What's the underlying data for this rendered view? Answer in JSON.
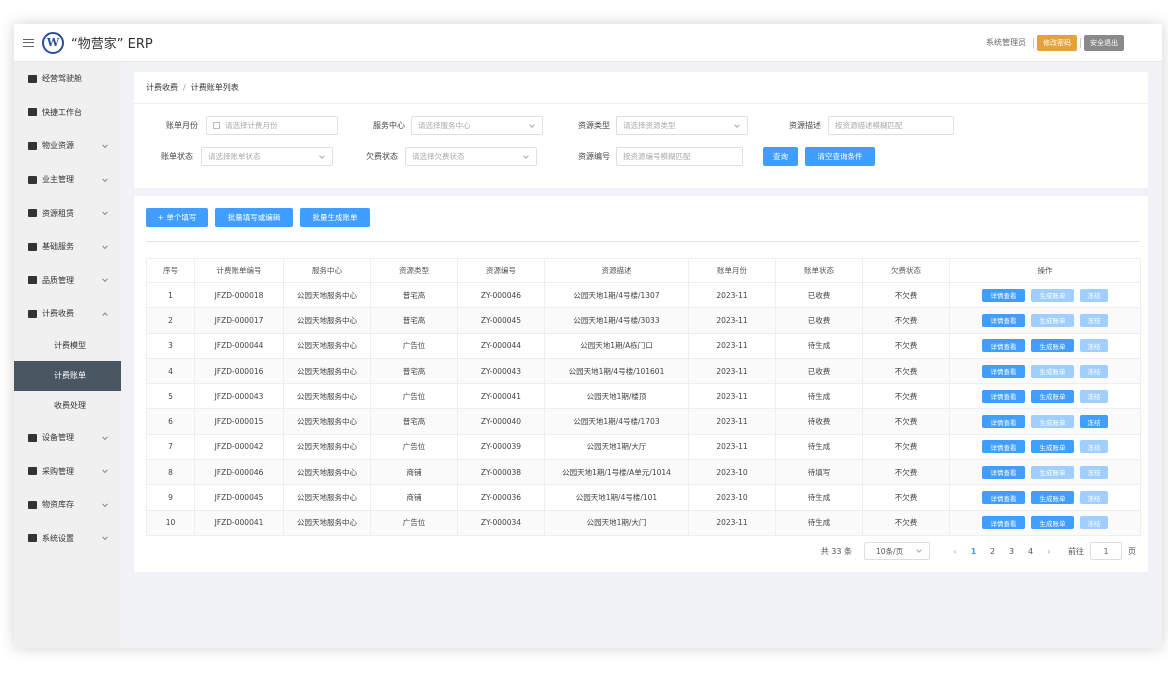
{
  "header": {
    "logo_text": "W",
    "app_title": "“物营家” ERP",
    "user": "系统管理员",
    "change_password": "修改密码",
    "logout": "安全退出"
  },
  "sidebar": {
    "items": [
      {
        "label": "经营驾驶舱",
        "icon": "briefcase-icon"
      },
      {
        "label": "快捷工作台",
        "icon": "calendar-check-icon"
      },
      {
        "label": "物业资源",
        "icon": "building-icon",
        "expandable": true
      },
      {
        "label": "业主管理",
        "icon": "users-icon",
        "expandable": true
      },
      {
        "label": "资源租赁",
        "icon": "briefcase-icon",
        "expandable": true
      },
      {
        "label": "基础服务",
        "icon": "bookmark-icon",
        "expandable": true
      },
      {
        "label": "品质管理",
        "icon": "calendar-icon",
        "expandable": true
      },
      {
        "label": "计费收费",
        "icon": "bookmark-icon",
        "expandable": true,
        "expanded": true
      }
    ],
    "sub_items": [
      {
        "label": "计费模型",
        "active": false
      },
      {
        "label": "计费账单",
        "active": true
      },
      {
        "label": "收费处理",
        "active": false
      }
    ],
    "items_after": [
      {
        "label": "设备管理",
        "icon": "calendar-check-icon"
      },
      {
        "label": "采购管理",
        "icon": "shopping-icon"
      },
      {
        "label": "物资库存",
        "icon": "calendar-check-icon"
      },
      {
        "label": "系统设置",
        "icon": "lock-icon"
      }
    ]
  },
  "breadcrumb": {
    "parent": "计费收费",
    "separator": "/",
    "current": "计费账单列表"
  },
  "filters": {
    "bill_month": {
      "label": "账单月份",
      "placeholder": "请选择计费月份"
    },
    "service_center": {
      "label": "服务中心",
      "placeholder": "请选择服务中心"
    },
    "resource_type": {
      "label": "资源类型",
      "placeholder": "请选择资源类型"
    },
    "resource_desc": {
      "label": "资源描述",
      "placeholder": "按资源描述模糊匹配"
    },
    "bill_status": {
      "label": "账单状态",
      "placeholder": "请选择账单状态"
    },
    "arrears_status": {
      "label": "欠费状态",
      "placeholder": "请选择欠费状态"
    },
    "resource_no": {
      "label": "资源编号",
      "placeholder": "按资源编号模糊匹配"
    },
    "query_button": "查询",
    "clear_button": "清空查询条件"
  },
  "actions": {
    "single_fill": "+ 单个填写",
    "batch_fill": "批量填写或编辑",
    "batch_generate": "批量生成账单"
  },
  "table": {
    "columns": [
      "序号",
      "计费账单编号",
      "服务中心",
      "资源类型",
      "资源编号",
      "资源描述",
      "账单月份",
      "账单状态",
      "欠费状态",
      "操作"
    ],
    "op_labels": {
      "detail": "详情查看",
      "generate": "生成账单",
      "freeze": "冻结"
    },
    "rows": [
      {
        "no": "1",
        "bill_no": "JFZD-000018",
        "center": "公园天地服务中心",
        "type": "普宅高",
        "res_no": "ZY-000046",
        "desc": "公园天地1期/4号楼/1307",
        "month": "2023-11",
        "status": "已收费",
        "arrears": "不欠费",
        "gen_enabled": false,
        "freeze_enabled": false
      },
      {
        "no": "2",
        "bill_no": "JFZD-000017",
        "center": "公园天地服务中心",
        "type": "普宅高",
        "res_no": "ZY-000045",
        "desc": "公园天地1期/4号楼/3033",
        "month": "2023-11",
        "status": "已收费",
        "arrears": "不欠费",
        "gen_enabled": false,
        "freeze_enabled": false
      },
      {
        "no": "3",
        "bill_no": "JFZD-000044",
        "center": "公园天地服务中心",
        "type": "广告位",
        "res_no": "ZY-000044",
        "desc": "公园天地1期/A栋门口",
        "month": "2023-11",
        "status": "待生成",
        "arrears": "不欠费",
        "gen_enabled": true,
        "freeze_enabled": false
      },
      {
        "no": "4",
        "bill_no": "JFZD-000016",
        "center": "公园天地服务中心",
        "type": "普宅高",
        "res_no": "ZY-000043",
        "desc": "公园天地1期/4号楼/101601",
        "month": "2023-11",
        "status": "已收费",
        "arrears": "不欠费",
        "gen_enabled": false,
        "freeze_enabled": false
      },
      {
        "no": "5",
        "bill_no": "JFZD-000043",
        "center": "公园天地服务中心",
        "type": "广告位",
        "res_no": "ZY-000041",
        "desc": "公园天地1期/楼顶",
        "month": "2023-11",
        "status": "待生成",
        "arrears": "不欠费",
        "gen_enabled": true,
        "freeze_enabled": false
      },
      {
        "no": "6",
        "bill_no": "JFZD-000015",
        "center": "公园天地服务中心",
        "type": "普宅高",
        "res_no": "ZY-000040",
        "desc": "公园天地1期/4号楼/1703",
        "month": "2023-11",
        "status": "待收费",
        "arrears": "不欠费",
        "gen_enabled": false,
        "freeze_enabled": true
      },
      {
        "no": "7",
        "bill_no": "JFZD-000042",
        "center": "公园天地服务中心",
        "type": "广告位",
        "res_no": "ZY-000039",
        "desc": "公园天地1期/大厅",
        "month": "2023-11",
        "status": "待生成",
        "arrears": "不欠费",
        "gen_enabled": true,
        "freeze_enabled": false
      },
      {
        "no": "8",
        "bill_no": "JFZD-000046",
        "center": "公园天地服务中心",
        "type": "商铺",
        "res_no": "ZY-000038",
        "desc": "公园天地1期/1号楼/A单元/1014",
        "month": "2023-10",
        "status": "待填写",
        "arrears": "不欠费",
        "gen_enabled": false,
        "freeze_enabled": false
      },
      {
        "no": "9",
        "bill_no": "JFZD-000045",
        "center": "公园天地服务中心",
        "type": "商铺",
        "res_no": "ZY-000036",
        "desc": "公园天地1期/4号楼/101",
        "month": "2023-10",
        "status": "待生成",
        "arrears": "不欠费",
        "gen_enabled": true,
        "freeze_enabled": false
      },
      {
        "no": "10",
        "bill_no": "JFZD-000041",
        "center": "公园天地服务中心",
        "type": "广告位",
        "res_no": "ZY-000034",
        "desc": "公园天地1期/大门",
        "month": "2023-11",
        "status": "待生成",
        "arrears": "不欠费",
        "gen_enabled": true,
        "freeze_enabled": false
      }
    ]
  },
  "pagination": {
    "total": "共 33 条",
    "page_size": "10条/页",
    "pages": [
      "1",
      "2",
      "3",
      "4"
    ],
    "current_page": "1",
    "goto_label": "前往",
    "goto_value": "1",
    "page_unit": "页"
  },
  "colors": {
    "primary": "#409eff",
    "primary_disabled": "#a0cfff",
    "sidebar_active": "#4a5662",
    "orange": "#e5a23c",
    "gray": "#8a8a8a"
  }
}
